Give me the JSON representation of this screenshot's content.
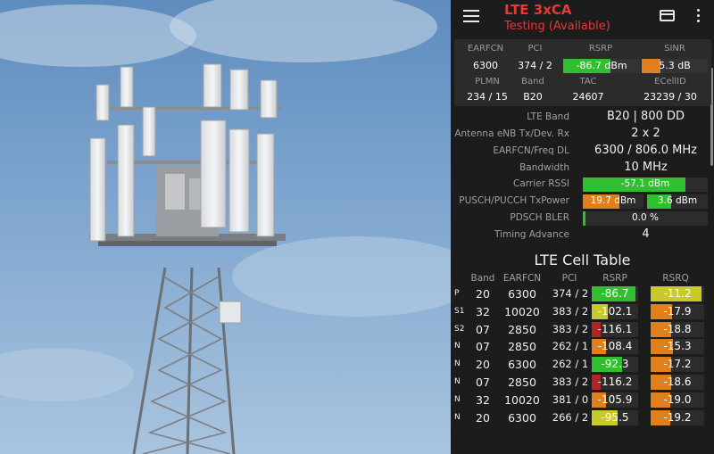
{
  "header": {
    "title": "LTE 3xCA",
    "subtitle": "Testing (Available)"
  },
  "icons": {
    "menu": "hamburger-menu-icon",
    "card": "credit-card-icon",
    "more": "more-vert-icon"
  },
  "colors": {
    "accent_red": "#e53935",
    "bar_green": "#2fbf2f",
    "bar_orange": "#e0801c",
    "bar_yellow": "#c9c92a",
    "bar_red": "#b02525"
  },
  "summary": {
    "labels": {
      "earfcn": "EARFCN",
      "pci": "PCI",
      "rsrp": "RSRP",
      "sinr": "SINR",
      "plmn": "PLMN",
      "band": "Band",
      "tac": "TAC",
      "ecellid": "ECellID"
    },
    "values": {
      "earfcn": "6300",
      "pci": "374 / 2",
      "rsrp": "-86.7 dBm",
      "sinr": "5.3 dB",
      "plmn": "234 / 15",
      "band": "B20",
      "tac": "24607",
      "ecellid": "23239 / 30"
    },
    "rsrp_level": 0.62,
    "sinr_level": 0.28
  },
  "details": {
    "lte_band_label": "LTE Band",
    "lte_band_value": "B20 | 800 DD",
    "antenna_label": "Antenna eNB Tx/Dev. Rx",
    "antenna_value": "2 x 2",
    "earfcn_label": "EARFCN/Freq DL",
    "earfcn_value": "6300 / 806.0 MHz",
    "bandwidth_label": "Bandwidth",
    "bandwidth_value": "10 MHz",
    "rssi_label": "Carrier RSSI",
    "rssi_value": "-57.1 dBm",
    "rssi_level": 0.82,
    "txpower_label": "PUSCH/PUCCH TxPower",
    "pusch_value": "19.7 dBm",
    "pusch_level": 0.6,
    "pucch_value": "3.6 dBm",
    "pucch_level": 0.4,
    "bler_label": "PDSCH BLER",
    "bler_value": "0.0 %",
    "bler_level": 0.02,
    "ta_label": "Timing Advance",
    "ta_value": "4"
  },
  "cell_table": {
    "title": "LTE Cell Table",
    "columns": [
      "Band",
      "EARFCN",
      "PCI",
      "RSRP",
      "RSRQ"
    ],
    "rows": [
      {
        "flag": "P",
        "band": "20",
        "earfcn": "6300",
        "pci": "374 / 2",
        "rsrp": "-86.7",
        "rsrq": "-11.2",
        "rsrp_level": 0.95,
        "rsrq_level": 0.95,
        "rsrp_color": "green",
        "rsrq_color": "yellow"
      },
      {
        "flag": "S1",
        "band": "32",
        "earfcn": "10020",
        "pci": "383 / 2",
        "rsrp": "-102.1",
        "rsrq": "-17.9",
        "rsrp_level": 0.35,
        "rsrq_level": 0.4,
        "rsrp_color": "yellow",
        "rsrq_color": "orange"
      },
      {
        "flag": "S2",
        "band": "07",
        "earfcn": "2850",
        "pci": "383 / 2",
        "rsrp": "-116.1",
        "rsrq": "-18.8",
        "rsrp_level": 0.2,
        "rsrq_level": 0.38,
        "rsrp_color": "red",
        "rsrq_color": "orange"
      },
      {
        "flag": "N",
        "band": "07",
        "earfcn": "2850",
        "pci": "262 / 1",
        "rsrp": "-108.4",
        "rsrq": "-15.3",
        "rsrp_level": 0.3,
        "rsrq_level": 0.42,
        "rsrp_color": "orange",
        "rsrq_color": "orange"
      },
      {
        "flag": "N",
        "band": "20",
        "earfcn": "6300",
        "pci": "262 / 1",
        "rsrp": "-92.3",
        "rsrq": "-17.2",
        "rsrp_level": 0.65,
        "rsrq_level": 0.38,
        "rsrp_color": "green",
        "rsrq_color": "orange"
      },
      {
        "flag": "N",
        "band": "07",
        "earfcn": "2850",
        "pci": "383 / 2",
        "rsrp": "-116.2",
        "rsrq": "-18.6",
        "rsrp_level": 0.2,
        "rsrq_level": 0.38,
        "rsrp_color": "red",
        "rsrq_color": "orange"
      },
      {
        "flag": "N",
        "band": "32",
        "earfcn": "10020",
        "pci": "381 / 0",
        "rsrp": "-105.9",
        "rsrq": "-19.0",
        "rsrp_level": 0.3,
        "rsrq_level": 0.36,
        "rsrp_color": "orange",
        "rsrq_color": "orange"
      },
      {
        "flag": "N",
        "band": "20",
        "earfcn": "6300",
        "pci": "266 / 2",
        "rsrp": "-95.5",
        "rsrq": "-19.2",
        "rsrp_level": 0.55,
        "rsrq_level": 0.36,
        "rsrp_color": "yellow",
        "rsrq_color": "orange"
      }
    ]
  }
}
